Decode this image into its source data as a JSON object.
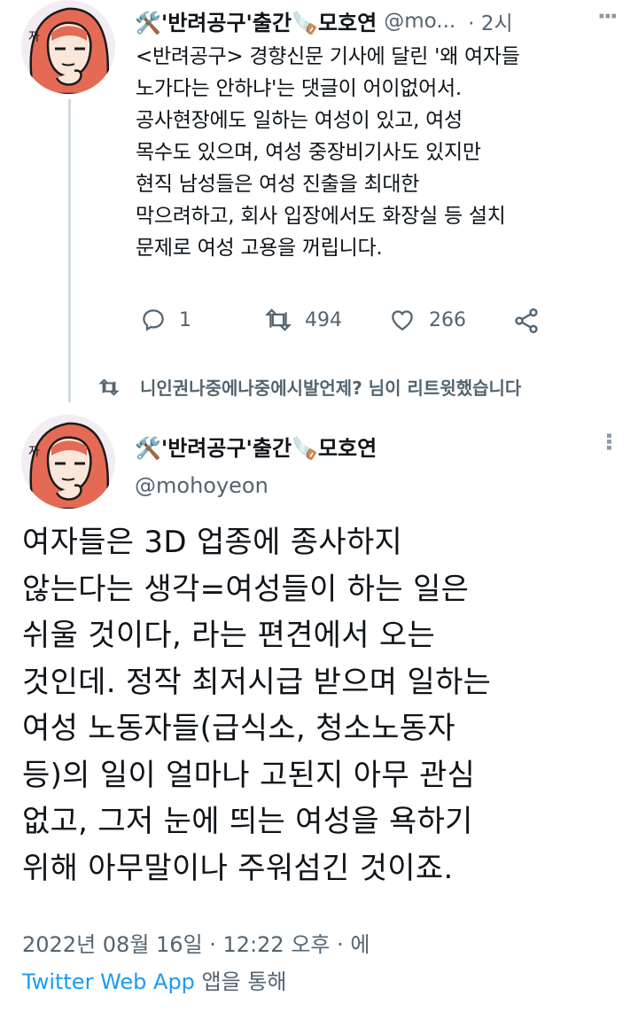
{
  "retweeted_tweet": {
    "display_name": "🛠️'반려공구'출간🪚모호연",
    "handle": "@mo...",
    "time": "· 2시",
    "text": "<반려공구> 경향신문 기사에 달린 '왜 여자들\n노가다는 안하냐'는 댓글이 어이없어서.\n공사현장에도 일하는 여성이 있고, 여성\n목수도 있으며, 여성 중장비기사도 있지만\n현직 남성들은 여성 진출을 최대한\n막으려하고, 회사 입장에서도 화장실 등 설치\n문제로 여성 고용을 꺼립니다.",
    "replies": "1",
    "retweets": "494",
    "likes": "266"
  },
  "retweet_note": "니인권나중에나중에시발언제? 님이 리트윗했습니다",
  "main_tweet": {
    "display_name": "🛠️'반려공구'출간🪚모호연",
    "handle": "@mohoyeon",
    "text": "여자들은 3D 업종에 종사하지\n않는다는 생각=여성들이 하는 일은\n쉬울 것이다, 라는 편견에서 오는\n것인데. 정작 최저시급 받으며 일하는\n여성 노동자들(급식소, 청소노동자\n등)의 일이 얼마나 고된지 아무 관심\n없고, 그저 눈에 띄는 여성을 욕하기\n위해 아무말이나 주워섬긴 것이죠.",
    "timestamp": "2022년 08월 16일 · 12:22 오후 · 에",
    "source_app": "Twitter Web App",
    "source_suffix": " 앱을 통해"
  },
  "colors": {
    "accent": "#1d9bf0",
    "secondary": "#536471",
    "line": "#cfd9de"
  }
}
